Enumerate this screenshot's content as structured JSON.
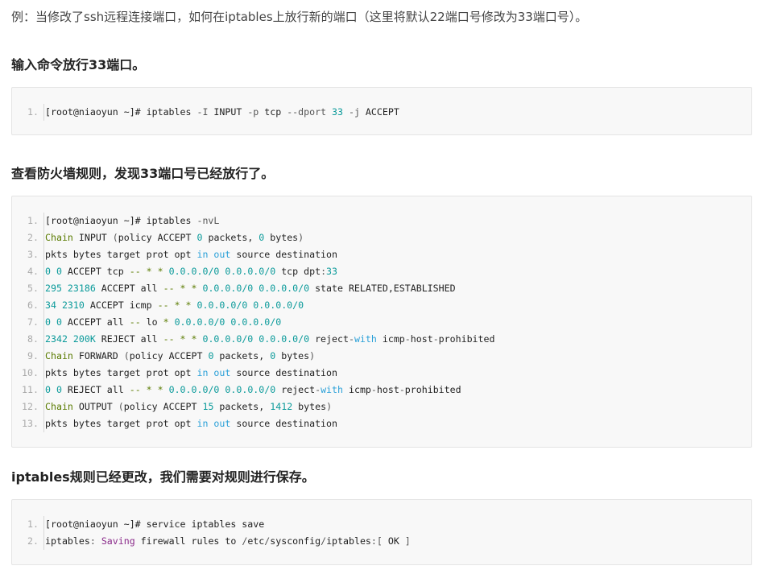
{
  "intro_text": "例：当修改了ssh远程连接端口，如何在iptables上放行新的端口（这里将默认22端口号修改为33端口号）。",
  "sections": [
    {
      "heading": "输入命令放行33端口。",
      "lines": [
        {
          "num": "1.",
          "tokens": [
            {
              "t": "[root@niaoyun ~]# ",
              "c": "plain"
            },
            {
              "t": "iptables ",
              "c": "plain"
            },
            {
              "t": "-I ",
              "c": "op"
            },
            {
              "t": "INPUT ",
              "c": "plain"
            },
            {
              "t": "-p ",
              "c": "op"
            },
            {
              "t": "tcp ",
              "c": "plain"
            },
            {
              "t": "--dport ",
              "c": "op"
            },
            {
              "t": "33",
              "c": "num"
            },
            {
              "t": " -j ",
              "c": "op"
            },
            {
              "t": "ACCEPT",
              "c": "plain"
            }
          ]
        }
      ]
    },
    {
      "heading": "查看防火墙规则，发现33端口号已经放行了。",
      "lines": [
        {
          "num": "1.",
          "tokens": [
            {
              "t": "[root@niaoyun ~]# ",
              "c": "plain"
            },
            {
              "t": "iptables ",
              "c": "plain"
            },
            {
              "t": "-nvL",
              "c": "op"
            }
          ]
        },
        {
          "num": "2.",
          "tokens": [
            {
              "t": "Chain",
              "c": "kw"
            },
            {
              "t": " INPUT ",
              "c": "plain"
            },
            {
              "t": "(",
              "c": "op"
            },
            {
              "t": "policy ACCEPT ",
              "c": "plain"
            },
            {
              "t": "0",
              "c": "num"
            },
            {
              "t": " packets, ",
              "c": "plain"
            },
            {
              "t": "0",
              "c": "num"
            },
            {
              "t": " bytes",
              "c": "plain"
            },
            {
              "t": ")",
              "c": "op"
            }
          ]
        },
        {
          "num": "3.",
          "tokens": [
            {
              "t": "pkts bytes target prot opt ",
              "c": "plain"
            },
            {
              "t": "in",
              "c": "blue"
            },
            {
              "t": " ",
              "c": "plain"
            },
            {
              "t": "out",
              "c": "blue"
            },
            {
              "t": " source destination",
              "c": "plain"
            }
          ]
        },
        {
          "num": "4.",
          "tokens": [
            {
              "t": "0 0",
              "c": "num"
            },
            {
              "t": " ACCEPT tcp ",
              "c": "plain"
            },
            {
              "t": "-- * *",
              "c": "kw"
            },
            {
              "t": " ",
              "c": "plain"
            },
            {
              "t": "0.0.0.0/0 0.0.0.0/0",
              "c": "num"
            },
            {
              "t": " tcp dpt",
              "c": "plain"
            },
            {
              "t": ":",
              "c": "op"
            },
            {
              "t": "33",
              "c": "num"
            }
          ]
        },
        {
          "num": "5.",
          "tokens": [
            {
              "t": "295 23186",
              "c": "num"
            },
            {
              "t": " ACCEPT all ",
              "c": "plain"
            },
            {
              "t": "-- * *",
              "c": "kw"
            },
            {
              "t": " ",
              "c": "plain"
            },
            {
              "t": "0.0.0.0/0 0.0.0.0/0",
              "c": "num"
            },
            {
              "t": " state RELATED,ESTABLISHED",
              "c": "plain"
            }
          ]
        },
        {
          "num": "6.",
          "tokens": [
            {
              "t": "34 2310",
              "c": "num"
            },
            {
              "t": " ACCEPT icmp ",
              "c": "plain"
            },
            {
              "t": "-- * *",
              "c": "kw"
            },
            {
              "t": " ",
              "c": "plain"
            },
            {
              "t": "0.0.0.0/0 0.0.0.0/0",
              "c": "num"
            }
          ]
        },
        {
          "num": "7.",
          "tokens": [
            {
              "t": "0 0",
              "c": "num"
            },
            {
              "t": " ACCEPT all ",
              "c": "plain"
            },
            {
              "t": "--",
              "c": "kw"
            },
            {
              "t": " lo ",
              "c": "plain"
            },
            {
              "t": "*",
              "c": "kw"
            },
            {
              "t": " ",
              "c": "plain"
            },
            {
              "t": "0.0.0.0/0 0.0.0.0/0",
              "c": "num"
            }
          ]
        },
        {
          "num": "8.",
          "tokens": [
            {
              "t": "2342 200K",
              "c": "num"
            },
            {
              "t": " REJECT all ",
              "c": "plain"
            },
            {
              "t": "-- * *",
              "c": "kw"
            },
            {
              "t": " ",
              "c": "plain"
            },
            {
              "t": "0.0.0.0/0 0.0.0.0/0",
              "c": "num"
            },
            {
              "t": " reject",
              "c": "plain"
            },
            {
              "t": "-",
              "c": "op"
            },
            {
              "t": "with",
              "c": "blue"
            },
            {
              "t": " icmp",
              "c": "plain"
            },
            {
              "t": "-",
              "c": "op"
            },
            {
              "t": "host",
              "c": "plain"
            },
            {
              "t": "-",
              "c": "op"
            },
            {
              "t": "prohibited",
              "c": "plain"
            }
          ]
        },
        {
          "num": "9.",
          "tokens": [
            {
              "t": "Chain",
              "c": "kw"
            },
            {
              "t": " FORWARD ",
              "c": "plain"
            },
            {
              "t": "(",
              "c": "op"
            },
            {
              "t": "policy ACCEPT ",
              "c": "plain"
            },
            {
              "t": "0",
              "c": "num"
            },
            {
              "t": " packets, ",
              "c": "plain"
            },
            {
              "t": "0",
              "c": "num"
            },
            {
              "t": " bytes",
              "c": "plain"
            },
            {
              "t": ")",
              "c": "op"
            }
          ]
        },
        {
          "num": "10.",
          "tokens": [
            {
              "t": "pkts bytes target prot opt ",
              "c": "plain"
            },
            {
              "t": "in",
              "c": "blue"
            },
            {
              "t": " ",
              "c": "plain"
            },
            {
              "t": "out",
              "c": "blue"
            },
            {
              "t": " source destination",
              "c": "plain"
            }
          ]
        },
        {
          "num": "11.",
          "tokens": [
            {
              "t": "0 0",
              "c": "num"
            },
            {
              "t": " REJECT all ",
              "c": "plain"
            },
            {
              "t": "-- * *",
              "c": "kw"
            },
            {
              "t": " ",
              "c": "plain"
            },
            {
              "t": "0.0.0.0/0 0.0.0.0/0",
              "c": "num"
            },
            {
              "t": " reject",
              "c": "plain"
            },
            {
              "t": "-",
              "c": "op"
            },
            {
              "t": "with",
              "c": "blue"
            },
            {
              "t": " icmp",
              "c": "plain"
            },
            {
              "t": "-",
              "c": "op"
            },
            {
              "t": "host",
              "c": "plain"
            },
            {
              "t": "-",
              "c": "op"
            },
            {
              "t": "prohibited",
              "c": "plain"
            }
          ]
        },
        {
          "num": "12.",
          "tokens": [
            {
              "t": "Chain",
              "c": "kw"
            },
            {
              "t": " OUTPUT ",
              "c": "plain"
            },
            {
              "t": "(",
              "c": "op"
            },
            {
              "t": "policy ACCEPT ",
              "c": "plain"
            },
            {
              "t": "15",
              "c": "num"
            },
            {
              "t": " packets, ",
              "c": "plain"
            },
            {
              "t": "1412",
              "c": "num"
            },
            {
              "t": " bytes",
              "c": "plain"
            },
            {
              "t": ")",
              "c": "op"
            }
          ]
        },
        {
          "num": "13.",
          "tokens": [
            {
              "t": "pkts bytes target prot opt ",
              "c": "plain"
            },
            {
              "t": "in",
              "c": "blue"
            },
            {
              "t": " ",
              "c": "plain"
            },
            {
              "t": "out",
              "c": "blue"
            },
            {
              "t": " source destination",
              "c": "plain"
            }
          ]
        }
      ]
    },
    {
      "heading": "iptables规则已经更改，我们需要对规则进行保存。",
      "lines": [
        {
          "num": "1.",
          "tokens": [
            {
              "t": "[root@niaoyun ~]# ",
              "c": "plain"
            },
            {
              "t": "service iptables save",
              "c": "plain"
            }
          ]
        },
        {
          "num": "2.",
          "tokens": [
            {
              "t": "iptables",
              "c": "plain"
            },
            {
              "t": ": ",
              "c": "op"
            },
            {
              "t": "Saving",
              "c": "pur"
            },
            {
              "t": " firewall rules to ",
              "c": "plain"
            },
            {
              "t": "/",
              "c": "op"
            },
            {
              "t": "etc",
              "c": "plain"
            },
            {
              "t": "/",
              "c": "op"
            },
            {
              "t": "sysconfig",
              "c": "plain"
            },
            {
              "t": "/",
              "c": "op"
            },
            {
              "t": "iptables",
              "c": "plain"
            },
            {
              "t": ":[ ",
              "c": "op"
            },
            {
              "t": "OK",
              "c": "plain"
            },
            {
              "t": " ]",
              "c": "op"
            }
          ]
        }
      ]
    }
  ],
  "colors": {
    "code_background": "#f8f8f8",
    "line_number": "#aaaaaa",
    "number_token": "#0a9a9a",
    "keyword_token": "#5a7b00",
    "blue_token": "#2aa0d8",
    "purple_token": "#8a2a8a"
  }
}
